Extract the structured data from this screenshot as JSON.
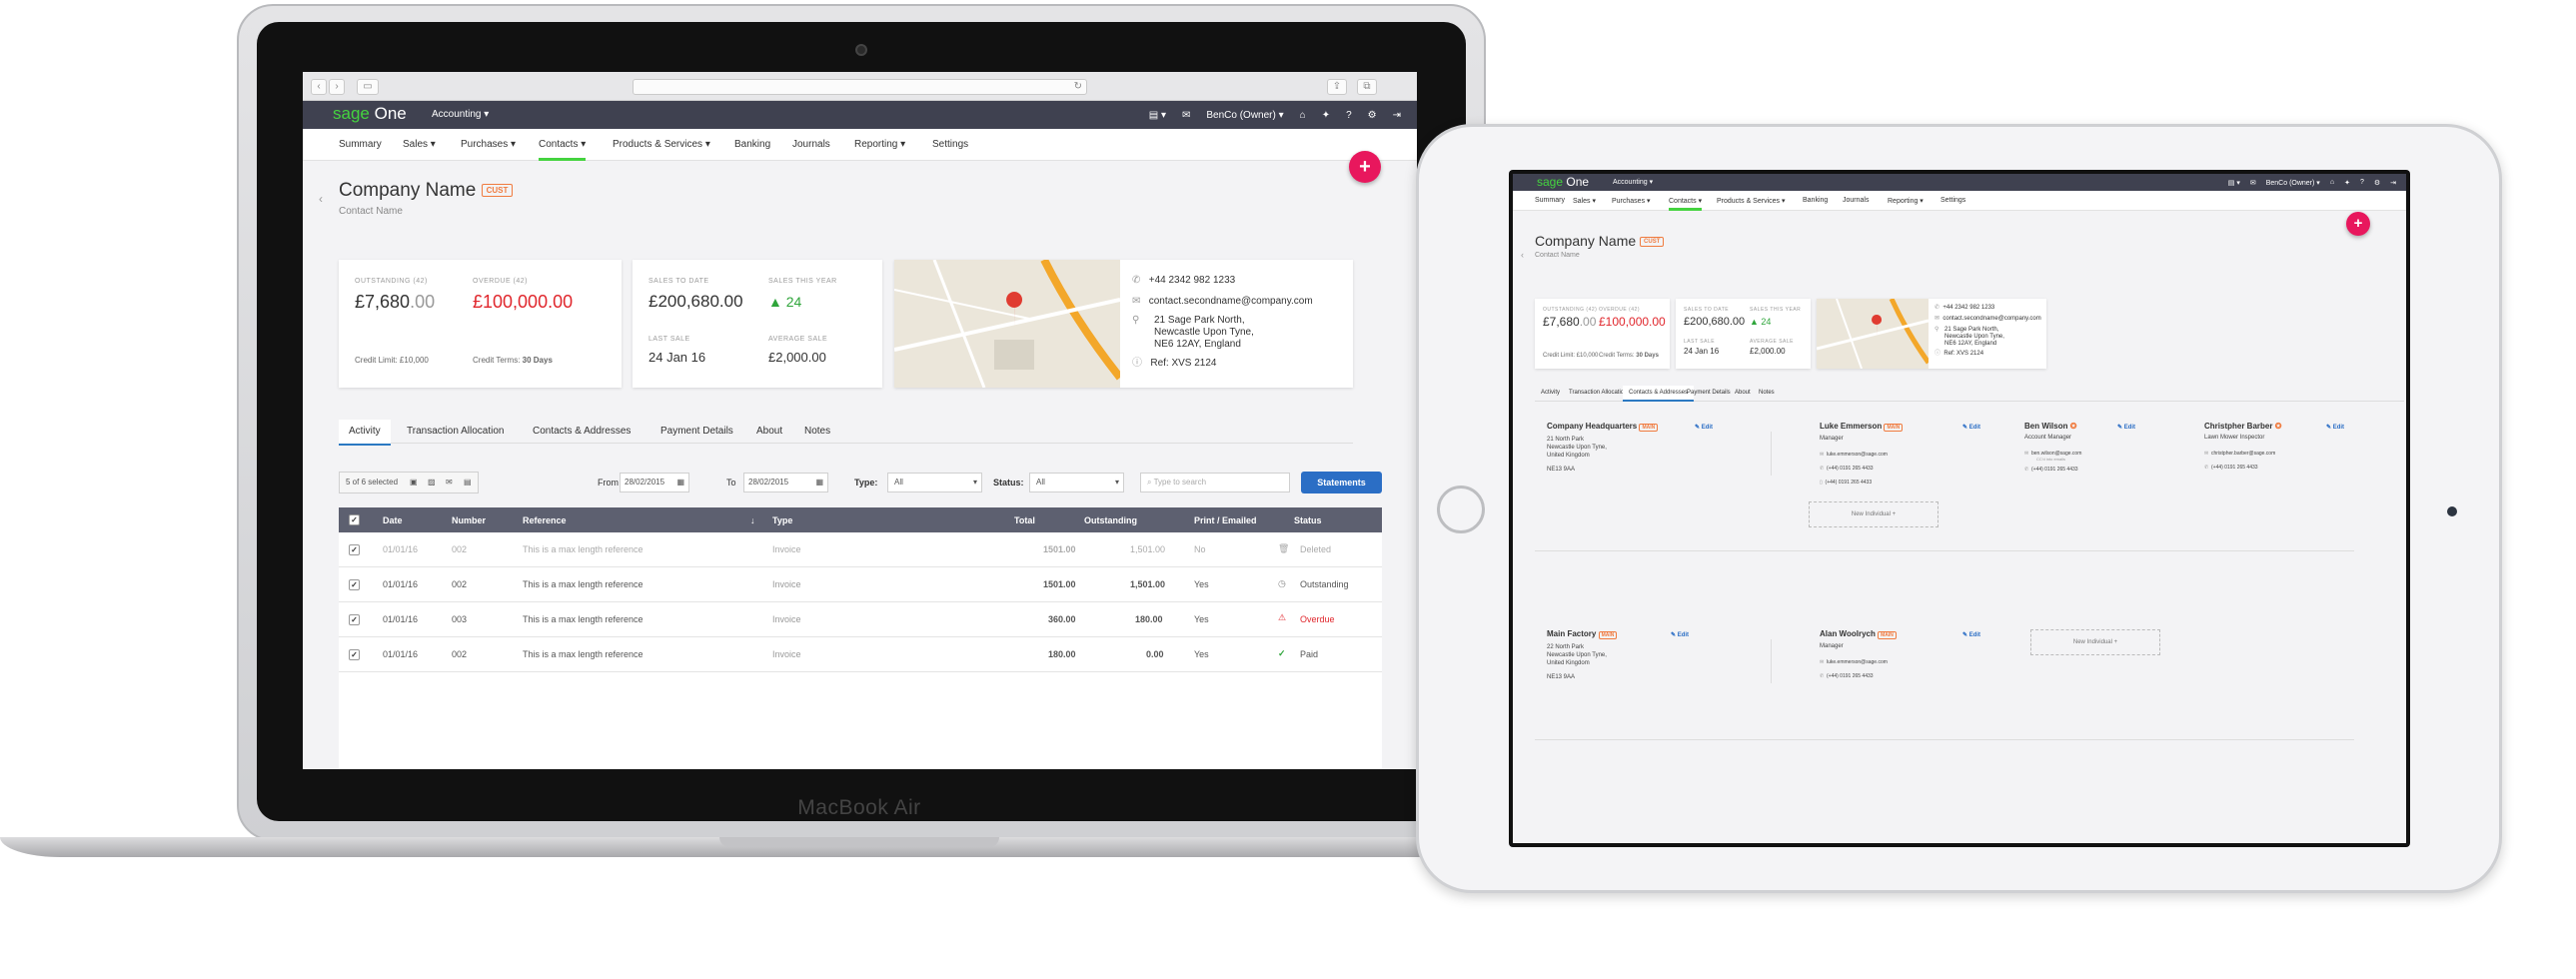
{
  "app": {
    "logo_a": "sage",
    "logo_b": "One",
    "menu": "Accounting",
    "user": "BenCo (Owner)"
  },
  "device_label": "MacBook Air",
  "nav": [
    "Summary",
    "Sales",
    "Purchases",
    "Contacts",
    "Products & Services",
    "Banking",
    "Journals",
    "Reporting",
    "Settings"
  ],
  "company": {
    "name": "Company Name",
    "badge": "CUST",
    "contact": "Contact Name"
  },
  "stats": {
    "outstanding_label": "OUTSTANDING (42)",
    "outstanding": "£7,680",
    "outstanding_dec": ".00",
    "overdue_label": "OVERDUE (42)",
    "overdue": "£100,000.00",
    "credit_limit_label": "Credit Limit:",
    "credit_limit": "£10,000",
    "credit_terms_label": "Credit Terms:",
    "credit_terms": "30 Days",
    "sales_to_date_label": "SALES TO DATE",
    "sales_to_date": "£200,680.00",
    "sales_year_label": "SALES THIS YEAR",
    "sales_year": "24",
    "last_sale_label": "LAST SALE",
    "last_sale": "24 Jan 16",
    "avg_sale_label": "AVERAGE SALE",
    "avg_sale": "£2,000.00"
  },
  "contact_info": {
    "phone": "+44 2342 982 1233",
    "email": "contact.secondname@company.com",
    "addr1": "21 Sage Park North,",
    "addr2": "Newcastle Upon Tyne,",
    "addr3": "NE6 12AY, England",
    "ref": "Ref: XVS 2124"
  },
  "tabs": [
    "Activity",
    "Transaction Allocation",
    "Contacts & Addresses",
    "Payment Details",
    "About",
    "Notes"
  ],
  "toolbar": {
    "selected": "5 of 6 selected",
    "from_label": "From",
    "from": "28/02/2015",
    "to_label": "To",
    "to": "28/02/2015",
    "type_label": "Type:",
    "type": "All",
    "status_label": "Status:",
    "status": "All",
    "search_placeholder": "Type to search",
    "statements": "Statements"
  },
  "table": {
    "headers": [
      "Date",
      "Number",
      "Reference",
      "Type",
      "Total",
      "Outstanding",
      "Print / Emailed",
      "Status"
    ],
    "rows": [
      {
        "date": "01/01/16",
        "number": "002",
        "reference": "This is a max length reference",
        "type": "Invoice",
        "total": "1501.00",
        "outstanding": "1,501.00",
        "printed": "No",
        "status": "Deleted"
      },
      {
        "date": "01/01/16",
        "number": "002",
        "reference": "This is a max length reference",
        "type": "Invoice",
        "total": "1501.00",
        "outstanding": "1,501.00",
        "printed": "Yes",
        "status": "Outstanding"
      },
      {
        "date": "01/01/16",
        "number": "003",
        "reference": "This is a max length reference",
        "type": "Invoice",
        "total": "360.00",
        "outstanding": "180.00",
        "printed": "Yes",
        "status": "Overdue"
      },
      {
        "date": "01/01/16",
        "number": "002",
        "reference": "This is a max length reference",
        "type": "Invoice",
        "total": "180.00",
        "outstanding": "0.00",
        "printed": "Yes",
        "status": "Paid"
      }
    ]
  },
  "addresses": {
    "edit": "Edit",
    "main": "MAIN",
    "new_individual": "New Individual",
    "hq": {
      "name": "Company Headquarters",
      "l1": "21 North Park",
      "l2": "Newcastle Upon Tyne,",
      "l3": "United Kingdom",
      "pc": "NE13 9AA"
    },
    "factory": {
      "name": "Main Factory",
      "l1": "22 North Park",
      "l2": "Newcastle Upon Tyne,",
      "l3": "United Kingdom",
      "pc": "NE13 9AA"
    },
    "people": [
      {
        "name": "Luke Emmerson",
        "role": "Manager",
        "email": "luke.emmerson@sage.com",
        "phone": "(+44) 0191 265 4433",
        "mobile": "(+44) 0191 265 4433"
      },
      {
        "name": "Ben Wilson",
        "role": "Account Manager",
        "email": "ben.wilson@sage.com",
        "note": "CC'd into emails",
        "phone": "(+44) 0191 265 4433"
      },
      {
        "name": "Christpher Barber",
        "role": "Lawn Mower Inspector",
        "email": "christpher.barber@sage.com",
        "phone": "(+44) 0191 265 4433"
      },
      {
        "name": "Alan Woolrych",
        "role": "Manager",
        "email": "luke.emmerson@sage.com",
        "phone": "(+44) 0191 265 4433"
      }
    ]
  }
}
